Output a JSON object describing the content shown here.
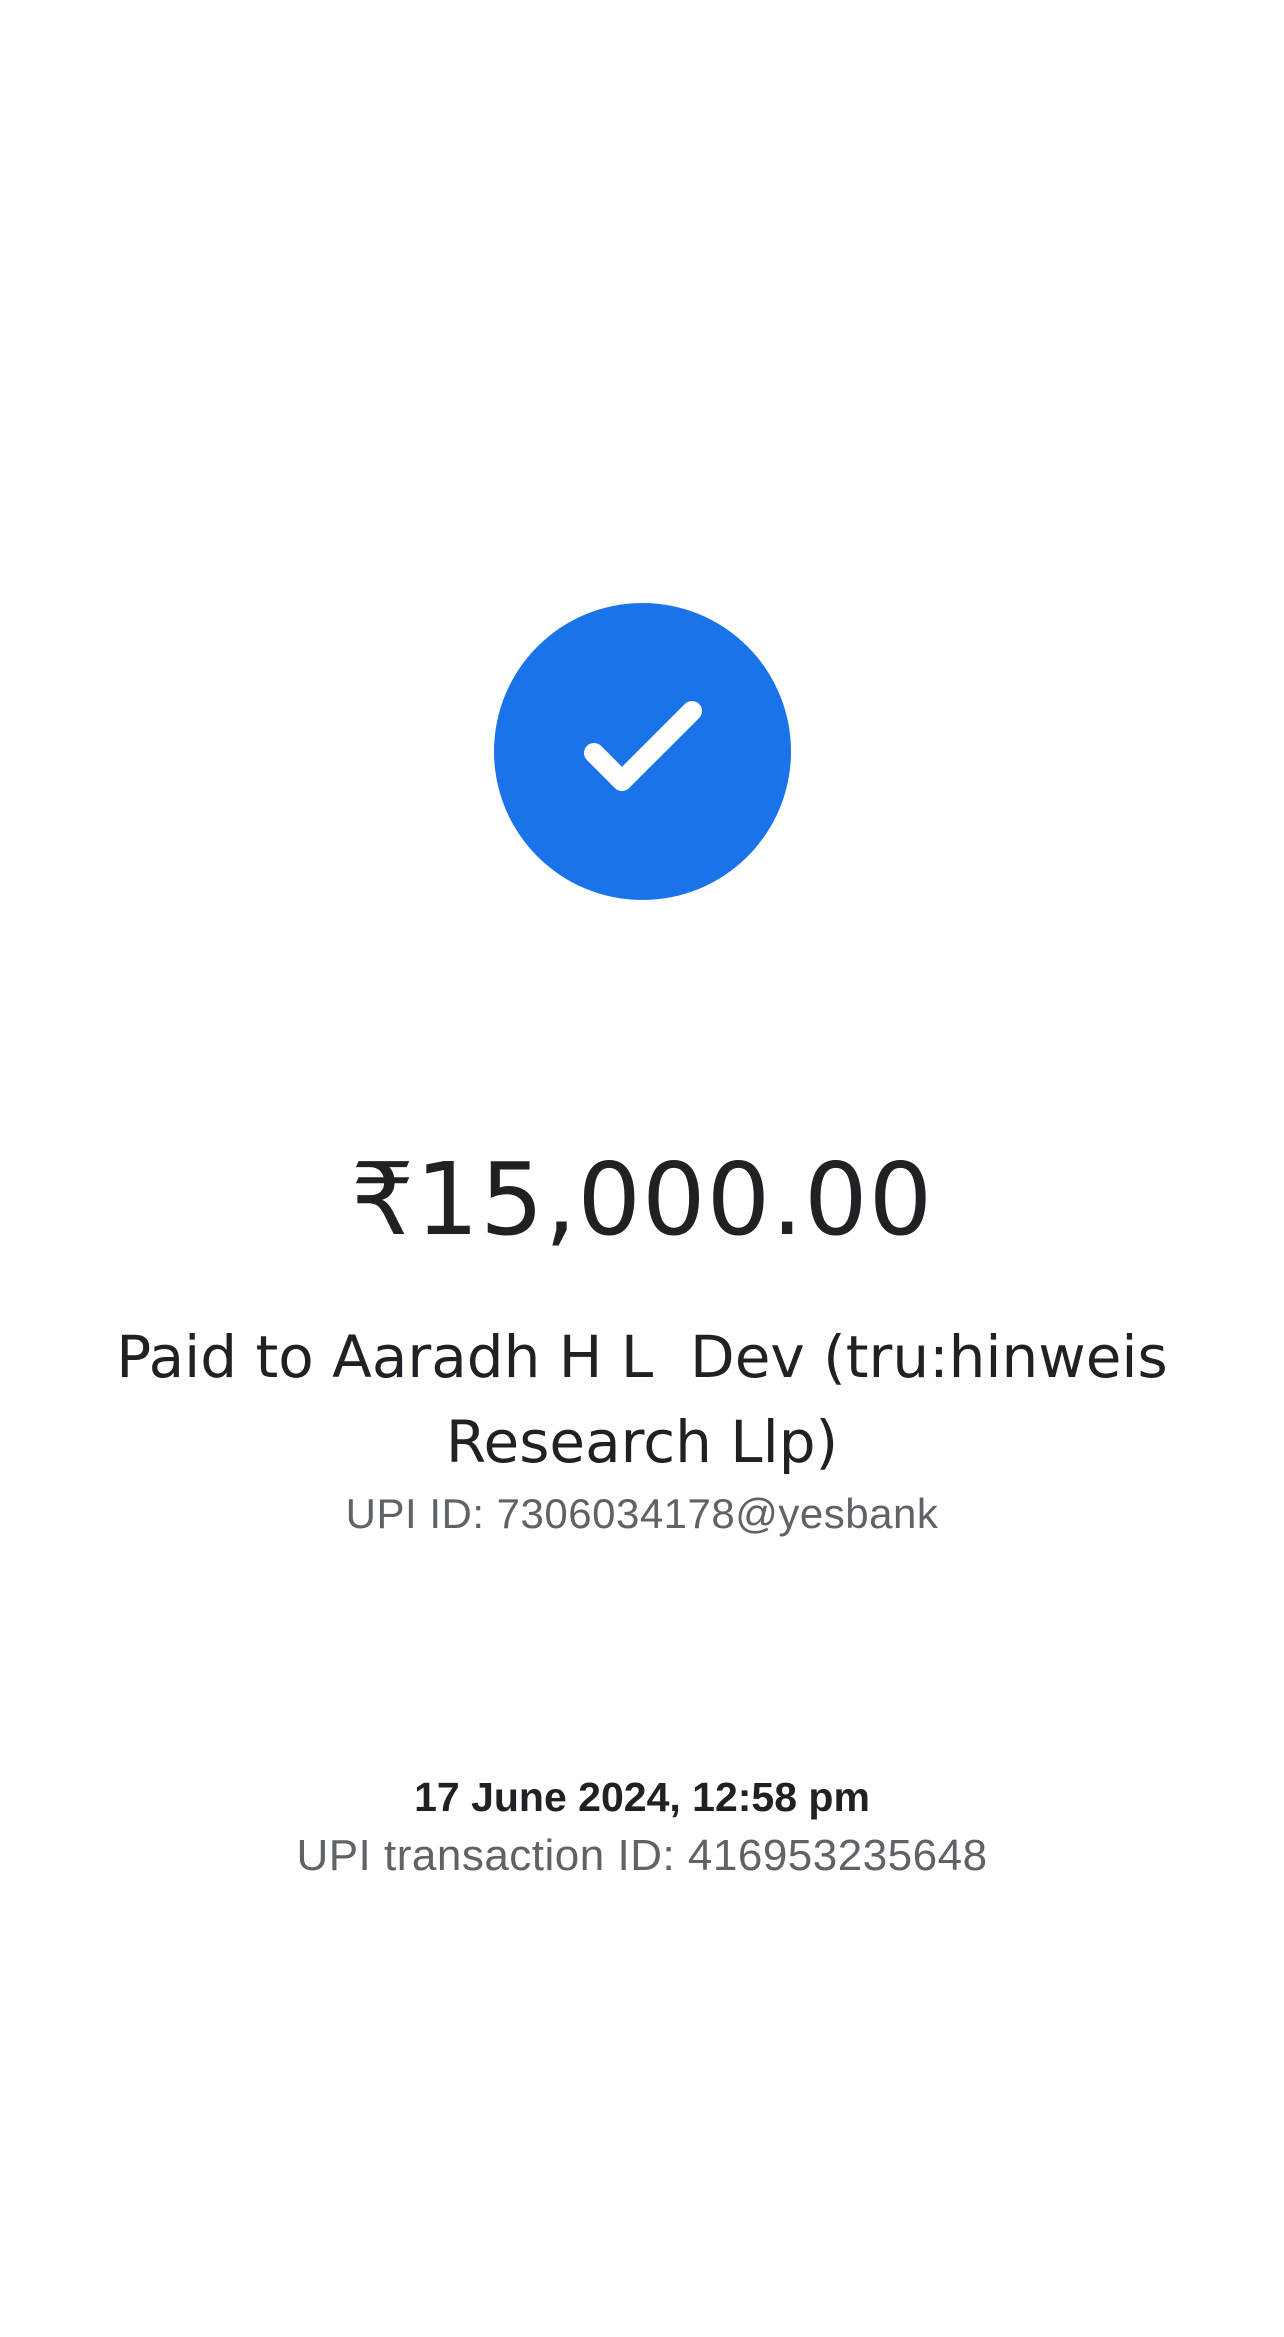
{
  "status": {
    "icon": "check-circle-icon",
    "color": "#1a73e8"
  },
  "payment": {
    "amount": "₹15,000.00",
    "paid_to": "Paid to Aaradh H L  Dev (tru:hinweis Research Llp)",
    "upi_id": "UPI ID: 7306034178@yesbank",
    "datetime": "17 June 2024, 12:58 pm",
    "transaction_id": "UPI transaction ID: 416953235648"
  }
}
